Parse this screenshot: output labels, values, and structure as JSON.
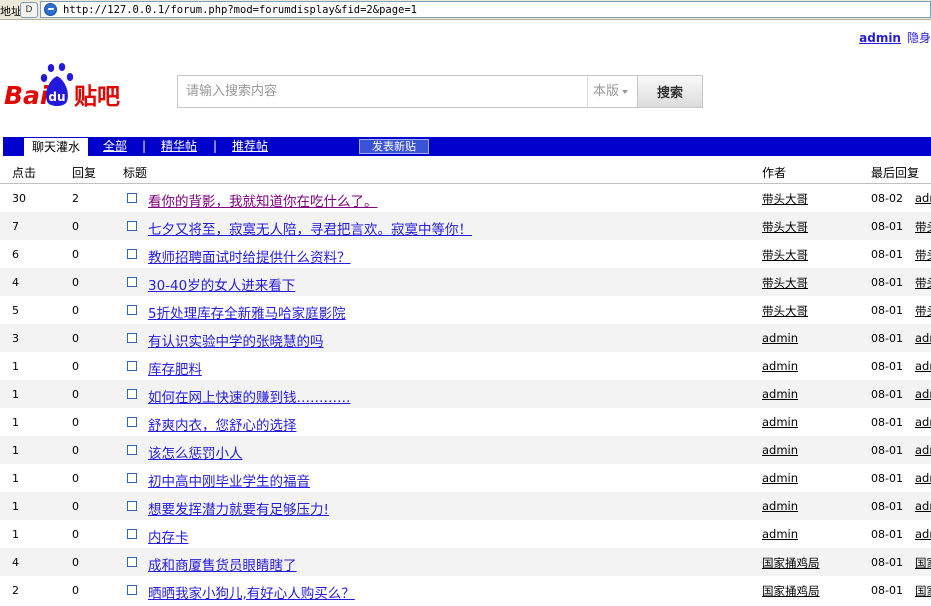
{
  "browser": {
    "address_label": "地址",
    "url": "http://127.0.0.1/forum.php?mod=forumdisplay&fid=2&page=1"
  },
  "user": {
    "name": "admin",
    "hide_label": "隐身"
  },
  "logo": {
    "bai": "Bai",
    "du": "du",
    "tieba": "贴吧"
  },
  "search": {
    "placeholder": "请输入搜索内容",
    "scope": "本版",
    "button": "搜索"
  },
  "nav": {
    "tabs": [
      "聊天灌水",
      "全部",
      "精华帖",
      "推荐帖"
    ],
    "new_post": "发表新贴"
  },
  "table": {
    "headers": {
      "clicks": "点击",
      "replies": "回复",
      "title": "标题",
      "author": "作者",
      "last_reply": "最后回复"
    },
    "rows": [
      {
        "clicks": "30",
        "replies": "2",
        "title": "看你的背影，我就知道你在吃什么了。",
        "author": "带头大哥",
        "date": "08-02",
        "last": "admin",
        "visited": true
      },
      {
        "clicks": "7",
        "replies": "0",
        "title": "七夕又将至，寂寞无人陪，寻君把言欢。寂寞中等你！",
        "author": "带头大哥",
        "date": "08-01",
        "last": "带头大哥"
      },
      {
        "clicks": "6",
        "replies": "0",
        "title": "教师招聘面试时给提供什么资料？",
        "author": "带头大哥",
        "date": "08-01",
        "last": "带头大哥"
      },
      {
        "clicks": "4",
        "replies": "0",
        "title": "30-40岁的女人进来看下",
        "author": "带头大哥",
        "date": "08-01",
        "last": "带头大哥"
      },
      {
        "clicks": "5",
        "replies": "0",
        "title": "5折处理库存全新雅马哈家庭影院",
        "author": "带头大哥",
        "date": "08-01",
        "last": "带头大哥"
      },
      {
        "clicks": "3",
        "replies": "0",
        "title": "有认识实验中学的张晓慧的吗",
        "author": "admin",
        "date": "08-01",
        "last": "admin"
      },
      {
        "clicks": "1",
        "replies": "0",
        "title": "库存肥料",
        "author": "admin",
        "date": "08-01",
        "last": "admin"
      },
      {
        "clicks": "1",
        "replies": "0",
        "title": "如何在网上快速的赚到钱…………",
        "author": "admin",
        "date": "08-01",
        "last": "admin"
      },
      {
        "clicks": "1",
        "replies": "0",
        "title": "舒爽内衣，您舒心的选择",
        "author": "admin",
        "date": "08-01",
        "last": "admin"
      },
      {
        "clicks": "1",
        "replies": "0",
        "title": "该怎么惩罚小人",
        "author": "admin",
        "date": "08-01",
        "last": "admin"
      },
      {
        "clicks": "1",
        "replies": "0",
        "title": "初中高中刚毕业学生的福音",
        "author": "admin",
        "date": "08-01",
        "last": "admin"
      },
      {
        "clicks": "1",
        "replies": "0",
        "title": "想要发挥潜力就要有足够压力!",
        "author": "admin",
        "date": "08-01",
        "last": "admin"
      },
      {
        "clicks": "1",
        "replies": "0",
        "title": "内存卡",
        "author": "admin",
        "date": "08-01",
        "last": "admin"
      },
      {
        "clicks": "4",
        "replies": "0",
        "title": "成和商厦售货员眼睛瞎了",
        "author": "国家捅鸡局",
        "date": "08-01",
        "last": "国家捅鸡局"
      },
      {
        "clicks": "2",
        "replies": "0",
        "title": "晒晒我家小狗儿,有好心人购买么？",
        "author": "国家捅鸡局",
        "date": "08-01",
        "last": "国家捅鸡局"
      }
    ]
  }
}
